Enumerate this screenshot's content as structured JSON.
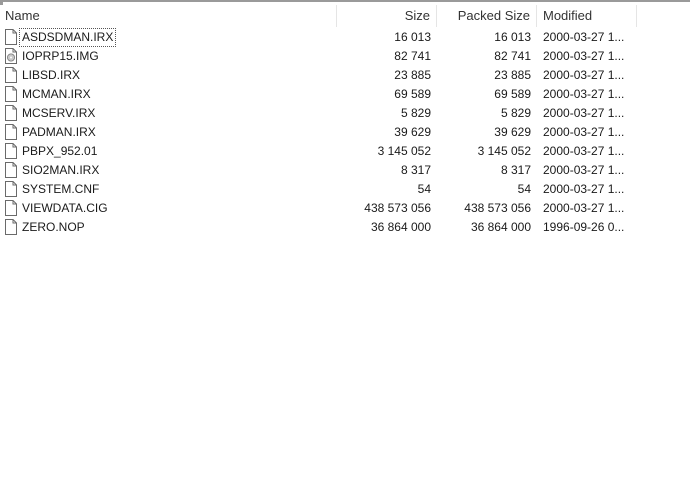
{
  "columns": {
    "name": "Name",
    "size": "Size",
    "packed": "Packed Size",
    "modified": "Modified"
  },
  "files": [
    {
      "name": "ASDSDMAN.IRX",
      "size": "16 013",
      "packed": "16 013",
      "modified": "2000-03-27 1...",
      "icon": "file-icon"
    },
    {
      "name": "IOPRP15.IMG",
      "size": "82 741",
      "packed": "82 741",
      "modified": "2000-03-27 1...",
      "icon": "disc-image-file-icon"
    },
    {
      "name": "LIBSD.IRX",
      "size": "23 885",
      "packed": "23 885",
      "modified": "2000-03-27 1...",
      "icon": "file-icon"
    },
    {
      "name": "MCMAN.IRX",
      "size": "69 589",
      "packed": "69 589",
      "modified": "2000-03-27 1...",
      "icon": "file-icon"
    },
    {
      "name": "MCSERV.IRX",
      "size": "5 829",
      "packed": "5 829",
      "modified": "2000-03-27 1...",
      "icon": "file-icon"
    },
    {
      "name": "PADMAN.IRX",
      "size": "39 629",
      "packed": "39 629",
      "modified": "2000-03-27 1...",
      "icon": "file-icon"
    },
    {
      "name": "PBPX_952.01",
      "size": "3 145 052",
      "packed": "3 145 052",
      "modified": "2000-03-27 1...",
      "icon": "file-icon"
    },
    {
      "name": "SIO2MAN.IRX",
      "size": "8 317",
      "packed": "8 317",
      "modified": "2000-03-27 1...",
      "icon": "file-icon"
    },
    {
      "name": "SYSTEM.CNF",
      "size": "54",
      "packed": "54",
      "modified": "2000-03-27 1...",
      "icon": "file-icon"
    },
    {
      "name": "VIEWDATA.CIG",
      "size": "438 573 056",
      "packed": "438 573 056",
      "modified": "2000-03-27 1...",
      "icon": "file-icon"
    },
    {
      "name": "ZERO.NOP",
      "size": "36 864 000",
      "packed": "36 864 000",
      "modified": "1996-09-26 0...",
      "icon": "file-icon"
    }
  ]
}
